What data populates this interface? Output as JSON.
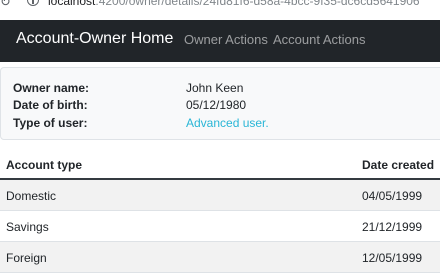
{
  "browser": {
    "url_host": "localhost",
    "url_path": ":4200/owner/details/24fd81f6-d58a-4bcc-9f35-dc6cd5641906"
  },
  "navbar": {
    "brand": "Account-Owner Home",
    "links": [
      "Owner Actions",
      "Account Actions"
    ]
  },
  "owner": {
    "fields": [
      {
        "label": "Owner name:",
        "value": "John Keen"
      },
      {
        "label": "Date of birth:",
        "value": "05/12/1980"
      },
      {
        "label": "Type of user:",
        "value": "Advanced user."
      }
    ]
  },
  "accounts": {
    "headers": [
      "Account type",
      "Date created"
    ],
    "rows": [
      {
        "type": "Domestic",
        "date": "04/05/1999"
      },
      {
        "type": "Savings",
        "date": "21/12/1999"
      },
      {
        "type": "Foreign",
        "date": "12/05/1999"
      }
    ]
  },
  "colors": {
    "navbar_bg": "#212529",
    "link_accent": "#29b6d6",
    "striped_row": "#f2f2f2"
  }
}
